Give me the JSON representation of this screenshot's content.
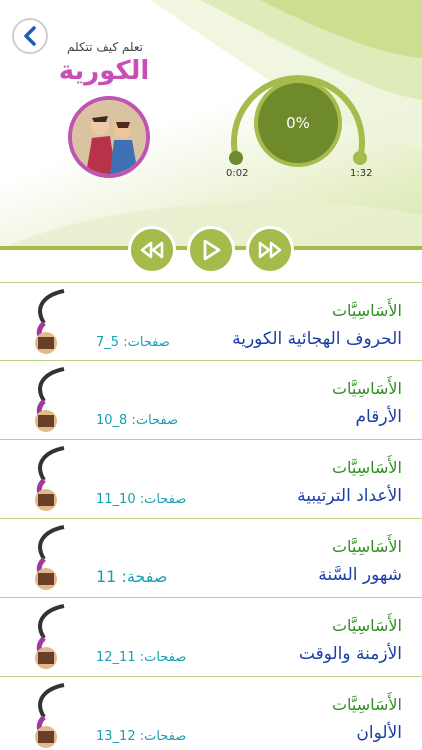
{
  "header": {
    "subtitle": "تعلم كيف تتكلم",
    "title": "الكورية"
  },
  "player": {
    "progress_text": "0%",
    "elapsed": "0:02",
    "duration": "1:32"
  },
  "items": [
    {
      "category": "الأَسَاسِيَّات",
      "title": "الحروف الهجائية الكورية",
      "pages": "صفحات: 5_7"
    },
    {
      "category": "الأَسَاسِيَّات",
      "title": "الأرقام",
      "pages": "صفحات: 8_10"
    },
    {
      "category": "الأَسَاسِيَّات",
      "title": "الأعداد الترتيبية",
      "pages": "صفحات: 10_11"
    },
    {
      "category": "الأَسَاسِيَّات",
      "title": "شهور السَّنة",
      "pages": "صفحة: 11"
    },
    {
      "category": "الأَسَاسِيَّات",
      "title": "الأزمنة والوقت",
      "pages": "صفحات: 11_12"
    },
    {
      "category": "الأَسَاسِيَّات",
      "title": "الألوان",
      "pages": "صفحات: 12_13"
    }
  ],
  "colors": {
    "accent_green": "#a5bb4c",
    "dark_green": "#6e8a2a",
    "category_green": "#2f8f1f",
    "title_blue": "#1b3fa8",
    "pages_teal": "#1a9fb2",
    "brand_pink": "#c94fb5"
  },
  "icons": {
    "back": "chevron-left-icon",
    "rewind": "rewind-icon",
    "play": "play-icon",
    "forward": "fast-forward-icon"
  }
}
